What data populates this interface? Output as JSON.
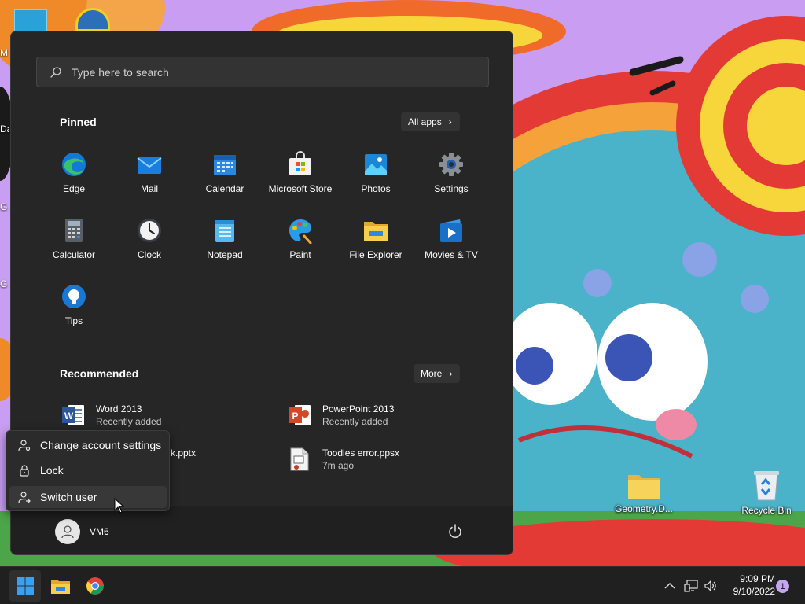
{
  "desktop": {
    "icons": [
      {
        "label": "Geometry.D..."
      },
      {
        "label": "Recycle Bin"
      }
    ],
    "edge_labels": [
      "M",
      "Da",
      "G",
      "G"
    ]
  },
  "start_menu": {
    "search_placeholder": "Type here to search",
    "pinned": {
      "title": "Pinned",
      "all_apps_label": "All apps",
      "apps": [
        {
          "label": "Edge",
          "icon": "edge-icon"
        },
        {
          "label": "Mail",
          "icon": "mail-icon"
        },
        {
          "label": "Calendar",
          "icon": "calendar-icon"
        },
        {
          "label": "Microsoft Store",
          "icon": "store-icon"
        },
        {
          "label": "Photos",
          "icon": "photos-icon"
        },
        {
          "label": "Settings",
          "icon": "gear-icon"
        },
        {
          "label": "Calculator",
          "icon": "calculator-icon"
        },
        {
          "label": "Clock",
          "icon": "clock-icon"
        },
        {
          "label": "Notepad",
          "icon": "notepad-icon"
        },
        {
          "label": "Paint",
          "icon": "paint-icon"
        },
        {
          "label": "File Explorer",
          "icon": "folder-icon"
        },
        {
          "label": "Movies & TV",
          "icon": "movies-icon"
        },
        {
          "label": "Tips",
          "icon": "lightbulb-icon"
        }
      ]
    },
    "recommended": {
      "title": "Recommended",
      "more_label": "More",
      "items": [
        {
          "name": "Word 2013",
          "sub": "Recently added",
          "icon": "word-icon"
        },
        {
          "name": "PowerPoint 2013",
          "sub": "Recently added",
          "icon": "powerpoint-icon"
        },
        {
          "name": "k.pptx",
          "sub": "",
          "icon": "pptx-file-icon"
        },
        {
          "name": "Toodles error.ppsx",
          "sub": "7m ago",
          "icon": "ppsx-file-icon"
        }
      ]
    },
    "user": {
      "name": "VM6"
    }
  },
  "account_menu": {
    "items": [
      {
        "label": "Change account settings",
        "icon": "account-settings-icon"
      },
      {
        "label": "Lock",
        "icon": "lock-icon"
      },
      {
        "label": "Switch user",
        "icon": "switch-user-icon"
      }
    ]
  },
  "taskbar": {
    "clock_time": "9:09 PM",
    "clock_date": "9/10/2022",
    "notification_count": "1"
  },
  "colors": {
    "accent": "#0078d4",
    "menu_bg": "#262626",
    "taskbar_bg": "#202020"
  }
}
